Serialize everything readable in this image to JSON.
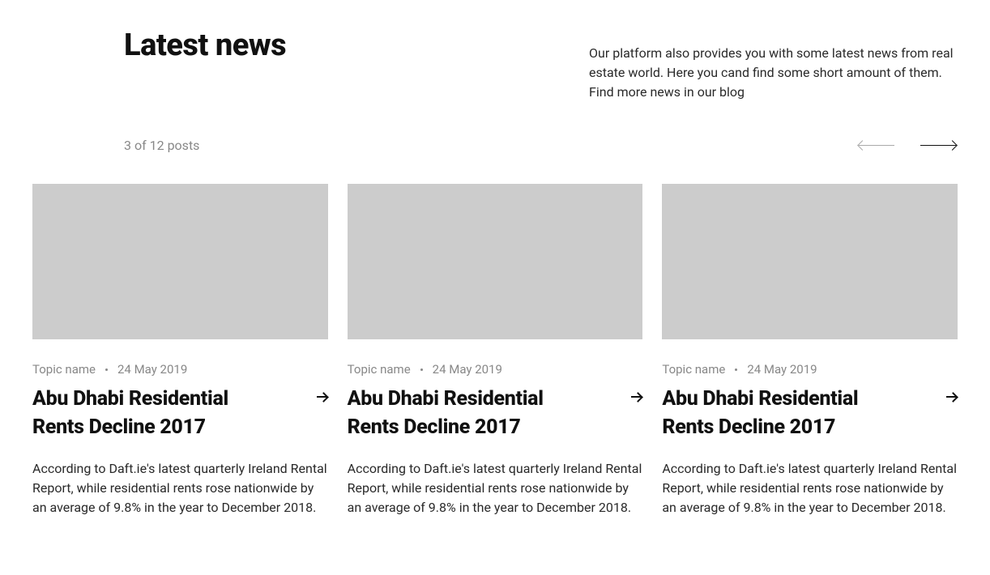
{
  "section_title": "Latest news",
  "description": "Our platform also provides you with some latest news from real estate world. Here you cand find some short amount of them. Find more news in our blog",
  "counter": "3 of 12 posts",
  "cards": [
    {
      "topic": "Topic name",
      "date": "24 May 2019",
      "title": "Abu Dhabi Residential Rents Decline 2017",
      "body": "According to Daft.ie's latest quarterly Ireland Rental Report, while residential rents rose nationwide by an average of 9.8% in the year to December 2018."
    },
    {
      "topic": "Topic name",
      "date": "24 May 2019",
      "title": "Abu Dhabi Residential Rents Decline 2017",
      "body": "According to Daft.ie's latest quarterly Ireland Rental Report, while residential rents rose nationwide by an average of 9.8% in the year to December 2018."
    },
    {
      "topic": "Topic name",
      "date": "24 May 2019",
      "title": "Abu Dhabi Residential Rents Decline 2017",
      "body": "According to Daft.ie's latest quarterly Ireland Rental Report, while residential rents rose nationwide by an average of 9.8% in the year to December 2018."
    }
  ]
}
